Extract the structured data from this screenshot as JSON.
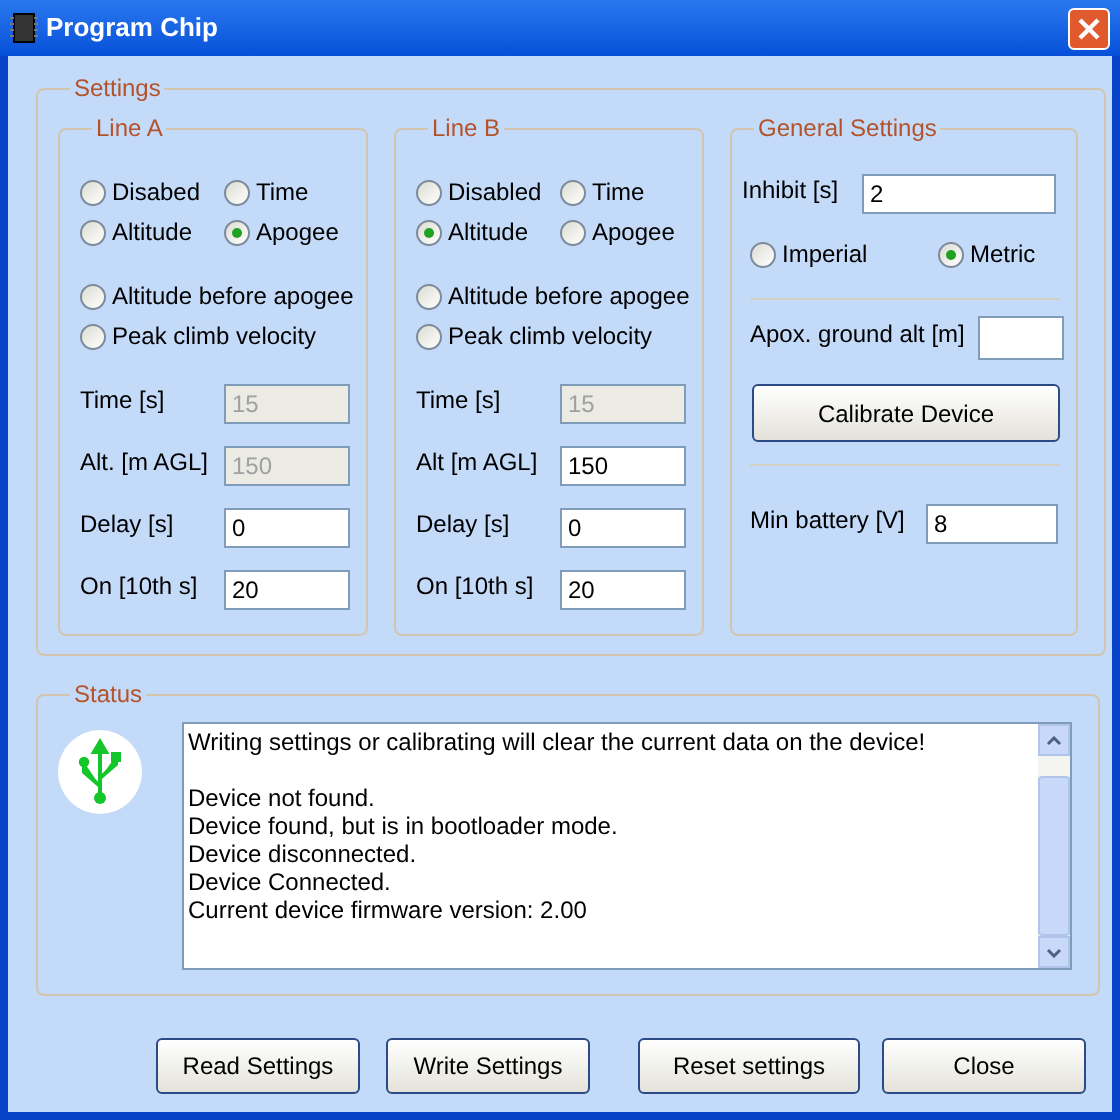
{
  "window": {
    "title": "Program Chip"
  },
  "settings": {
    "title": "Settings",
    "lines": [
      {
        "title": "Line A",
        "modes": [
          {
            "label": "Disabed",
            "selected": false
          },
          {
            "label": "Time",
            "selected": false
          },
          {
            "label": "Altitude",
            "selected": false
          },
          {
            "label": "Apogee",
            "selected": true
          },
          {
            "label": "Altitude before apogee",
            "selected": false
          },
          {
            "label": "Peak climb velocity",
            "selected": false
          }
        ],
        "fields": [
          {
            "label": "Time [s]",
            "value": "15",
            "disabled": true
          },
          {
            "label": "Alt. [m AGL]",
            "value": "150",
            "disabled": true
          },
          {
            "label": "Delay [s]",
            "value": "0",
            "disabled": false
          },
          {
            "label": "On [10th s]",
            "value": "20",
            "disabled": false
          }
        ]
      },
      {
        "title": "Line B",
        "modes": [
          {
            "label": "Disabled",
            "selected": false
          },
          {
            "label": "Time",
            "selected": false
          },
          {
            "label": "Altitude",
            "selected": true
          },
          {
            "label": "Apogee",
            "selected": false
          },
          {
            "label": "Altitude before apogee",
            "selected": false
          },
          {
            "label": "Peak climb velocity",
            "selected": false
          }
        ],
        "fields": [
          {
            "label": "Time [s]",
            "value": "15",
            "disabled": true
          },
          {
            "label": "Alt [m AGL]",
            "value": "150",
            "disabled": false
          },
          {
            "label": "Delay [s]",
            "value": "0",
            "disabled": false
          },
          {
            "label": "On [10th s]",
            "value": "20",
            "disabled": false
          }
        ]
      }
    ],
    "general": {
      "title": "General Settings",
      "items": [
        {
          "kind": "inhibit",
          "label": "Inhibit [s]",
          "value": "2"
        },
        {
          "kind": "units",
          "options": [
            {
              "label": "Imperial",
              "selected": false
            },
            {
              "label": "Metric",
              "selected": true
            }
          ]
        },
        {
          "kind": "divider"
        },
        {
          "kind": "ground",
          "label": "Apox. ground alt [m]"
        },
        {
          "kind": "button",
          "label": "Calibrate Device"
        },
        {
          "kind": "divider"
        },
        {
          "kind": "battery",
          "label": "Min battery [V]",
          "value": "8"
        }
      ]
    }
  },
  "status": {
    "title": "Status",
    "lines": [
      {
        "kind": "notice",
        "text": "Writing settings or calibrating will clear the current data on the device!"
      },
      {
        "kind": "log",
        "text": "Device not found."
      },
      {
        "kind": "log",
        "text": "Device found, but is in bootloader mode."
      },
      {
        "kind": "log",
        "text": "Device disconnected."
      },
      {
        "kind": "log",
        "text": "Device Connected."
      },
      {
        "kind": "log",
        "text": "Current device firmware version: 2.00"
      }
    ]
  },
  "buttons": [
    "Read Settings",
    "Write Settings",
    "Reset settings",
    "Close"
  ]
}
